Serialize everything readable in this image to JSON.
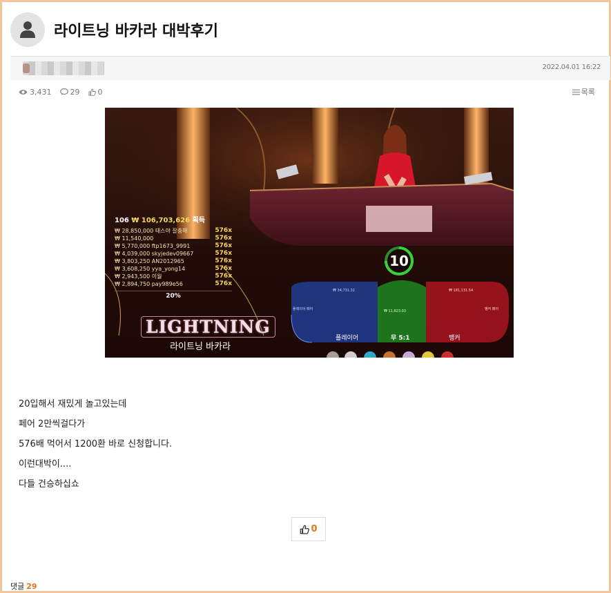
{
  "post": {
    "title": "라이트닝 바카라 대박후기",
    "datetime": "2022.04.01 16:22",
    "stats": {
      "views": "3,431",
      "comments": "29",
      "likes": "0"
    },
    "list_label": "목록",
    "body_lines": [
      "20입해서 재밌게 놀고있는데",
      "페어 2만씩걸다가",
      "576배 먹어서 1200환 바로 신청합니다.",
      "이런대박이....",
      "다들 건승하십쇼"
    ],
    "like_count": "0",
    "comments_label": "댓글",
    "comments_count": "29"
  },
  "game_screenshot": {
    "winners_header": {
      "count": "106",
      "amount": "₩ 106,703,626",
      "suffix": "획득"
    },
    "winners": [
      {
        "amount": "₩ 28,850,000",
        "name": "태스야 잘충해",
        "mult": "576x"
      },
      {
        "amount": "₩ 11,540,000",
        "name": "",
        "mult": "576x"
      },
      {
        "amount": "₩ 5,770,000",
        "name": "ftp1673_9991",
        "mult": "576x"
      },
      {
        "amount": "₩ 4,039,000",
        "name": "skyjedev09667",
        "mult": "576x"
      },
      {
        "amount": "₩ 3,803,250",
        "name": "AN2012965",
        "mult": "576x"
      },
      {
        "amount": "₩ 3,608,250",
        "name": "yya_yong14",
        "mult": "576x"
      },
      {
        "amount": "₩ 2,943,500",
        "name": "이월",
        "mult": "576x"
      },
      {
        "amount": "₩ 2,894,750",
        "name": "pay989e56",
        "mult": "576x"
      }
    ],
    "percent": "20%",
    "logo": "LIGHTNING",
    "logo_sub": "라이트닝 바카라",
    "timer": "10",
    "bets": {
      "player": "플레이어",
      "tie": "무 5:1",
      "banker": "뱅커",
      "player_pair": "플레이어 페어",
      "banker_pair": "뱅커 페어",
      "player_total": "₩ 34,731.32",
      "tie_total": "₩ 11,823.03",
      "banker_total": "₩ 181,131.54"
    }
  },
  "colors": {
    "border": "#f2c59a",
    "accent": "#e8731a"
  }
}
